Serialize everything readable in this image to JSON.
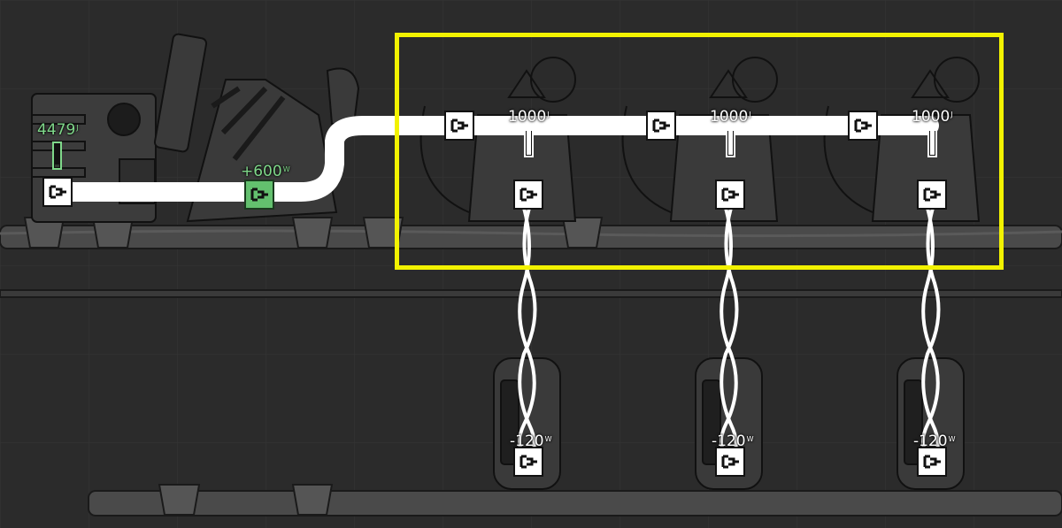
{
  "battery": {
    "charge_value": "4479",
    "charge_unit": "J",
    "charge_fraction": 0.12
  },
  "generator": {
    "output_value": "+600",
    "output_unit": "W"
  },
  "transformers": [
    {
      "charge_value": "1000",
      "charge_unit": "J",
      "charge_fraction": 1.0
    },
    {
      "charge_value": "1000",
      "charge_unit": "J",
      "charge_fraction": 1.0
    },
    {
      "charge_value": "1000",
      "charge_unit": "J",
      "charge_fraction": 1.0
    }
  ],
  "consumers": [
    {
      "power_value": "-120",
      "power_unit": "W"
    },
    {
      "power_value": "-120",
      "power_unit": "W"
    },
    {
      "power_value": "-120",
      "power_unit": "W"
    }
  ],
  "colors": {
    "highlight": "#f2f200",
    "producer_label": "#7fd88a",
    "wire": "#ffffff",
    "background": "#2b2b2b"
  },
  "icons": {
    "port": "power-port-icon",
    "gauge": "charge-gauge-icon"
  }
}
